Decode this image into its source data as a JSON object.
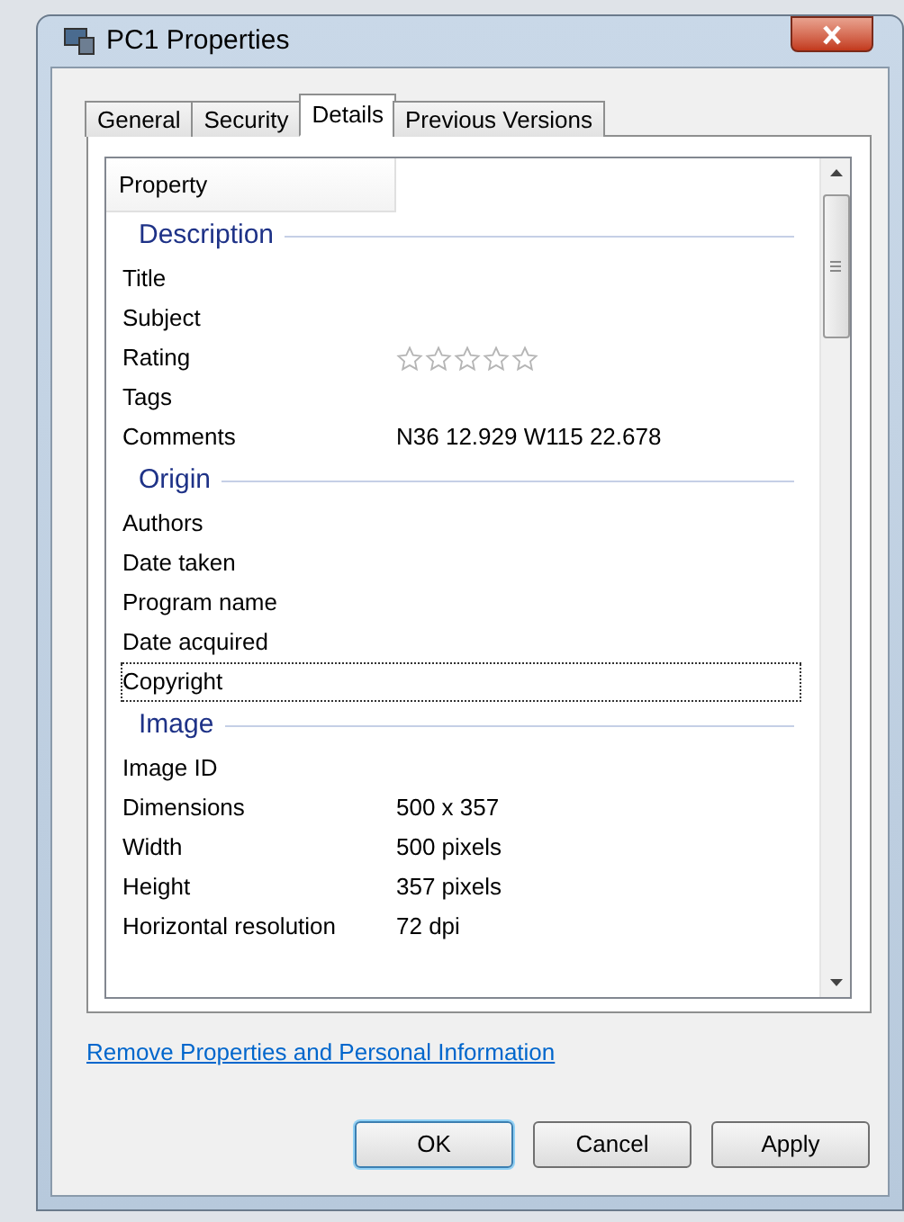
{
  "window": {
    "title": "PC1 Properties"
  },
  "tabs": [
    {
      "label": "General",
      "selected": false
    },
    {
      "label": "Security",
      "selected": false
    },
    {
      "label": "Details",
      "selected": true
    },
    {
      "label": "Previous Versions",
      "selected": false
    }
  ],
  "list": {
    "columns": [
      "Property"
    ],
    "groups": [
      {
        "label": "Description",
        "rows": [
          {
            "kind": "text",
            "property": "Title",
            "value": "",
            "focused": false
          },
          {
            "kind": "text",
            "property": "Subject",
            "value": "",
            "focused": false
          },
          {
            "kind": "rating",
            "property": "Rating",
            "stars": 0,
            "focused": false
          },
          {
            "kind": "text",
            "property": "Tags",
            "value": "",
            "focused": false
          },
          {
            "kind": "text",
            "property": "Comments",
            "value": "N36 12.929 W115 22.678",
            "focused": false
          }
        ]
      },
      {
        "label": "Origin",
        "rows": [
          {
            "kind": "text",
            "property": "Authors",
            "value": "",
            "focused": false
          },
          {
            "kind": "text",
            "property": "Date taken",
            "value": "",
            "focused": false
          },
          {
            "kind": "text",
            "property": "Program name",
            "value": "",
            "focused": false
          },
          {
            "kind": "text",
            "property": "Date acquired",
            "value": "",
            "focused": false
          },
          {
            "kind": "text",
            "property": "Copyright",
            "value": "",
            "focused": true
          }
        ]
      },
      {
        "label": "Image",
        "rows": [
          {
            "kind": "text",
            "property": "Image ID",
            "value": "",
            "focused": false
          },
          {
            "kind": "text",
            "property": "Dimensions",
            "value": "500 x 357",
            "focused": false
          },
          {
            "kind": "text",
            "property": "Width",
            "value": "500 pixels",
            "focused": false
          },
          {
            "kind": "text",
            "property": "Height",
            "value": "357 pixels",
            "focused": false
          },
          {
            "kind": "text",
            "property": "Horizontal resolution",
            "value": "72 dpi",
            "focused": false
          }
        ]
      }
    ]
  },
  "link": "Remove Properties and Personal Information",
  "buttons": [
    {
      "label": "OK",
      "default": true
    },
    {
      "label": "Cancel",
      "default": false
    },
    {
      "label": "Apply",
      "default": false
    }
  ]
}
